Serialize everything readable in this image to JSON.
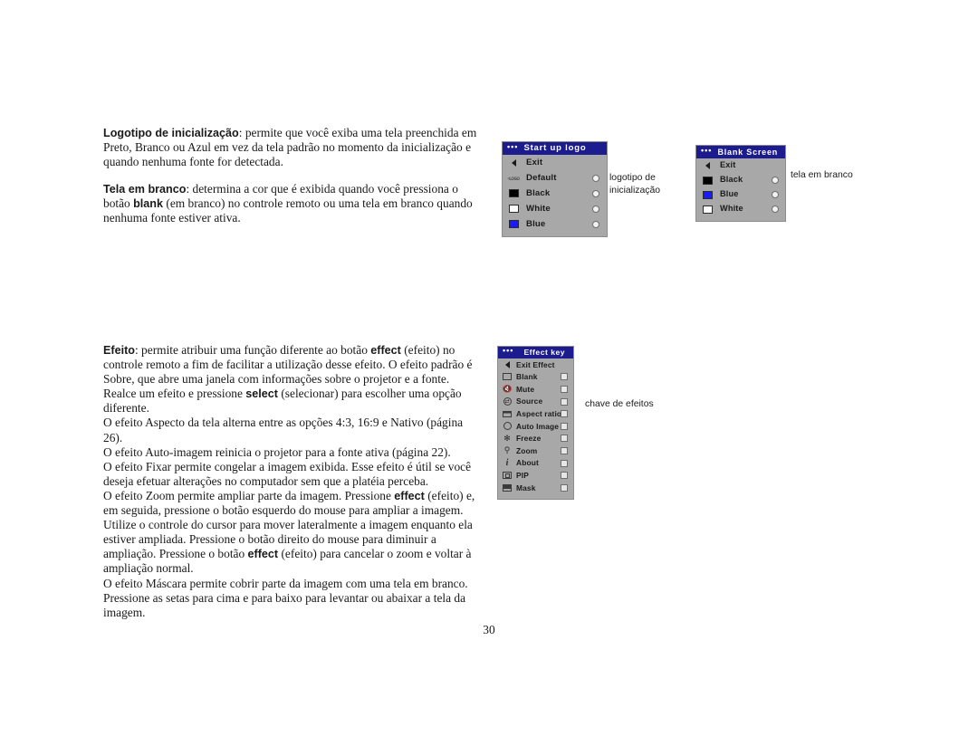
{
  "document": {
    "page_number": "30",
    "paragraphs_top": [
      {
        "lead": "Logotipo de inicialização",
        "text": ": permite que você exiba uma tela preenchida em Preto, Branco ou Azul em vez da tela padrão no momento da inicialização e quando nenhuma fonte for detectada."
      },
      {
        "lead": "Tela em branco",
        "text": ": determina a cor que é exibida quando você pressiona o botão blank (em branco) no controle remoto ou uma tela em branco quando nenhuma fonte estiver ativa."
      }
    ],
    "paragraphs_bottom": [
      {
        "lead": "Efeito",
        "text": ": permite atribuir uma função diferente ao botão effect (efeito) no controle remoto a fim de facilitar a utilização desse efeito. O efeito padrão é Sobre, que abre uma janela com informações  sobre o projetor e a fonte. Realce um efeito e pressione select (selecionar) para escolher uma opção diferente."
      },
      {
        "lead": "",
        "text": "O efeito Aspecto da tela alterna entre as opções 4:3, 16:9 e Nativo (página 26)."
      },
      {
        "lead": "",
        "text": "O efeito Auto-imagem reinicia o projetor para a fonte ativa (página 22)."
      },
      {
        "lead": "",
        "text": "O efeito Fixar permite congelar a imagem exibida. Esse efeito é útil se você deseja efetuar alterações no computador sem que a platéia perceba."
      },
      {
        "lead": "",
        "text": "O efeito Zoom permite ampliar parte da imagem. Pressione effect (efeito) e, em seguida, pressione o botão esquerdo do mouse para ampliar a imagem. Utilize o controle do cursor para mover lateralmente a imagem enquanto ela estiver ampliada. Pressione o botão direito do mouse para diminuir a ampliação. Pressione o botão effect (efeito) para cancelar o zoom e voltar à ampliação normal."
      },
      {
        "lead": "",
        "text": "O efeito Máscara permite cobrir parte da imagem com uma tela em branco. Pressione as setas para cima e para baixo para levantar ou abaixar a tela da imagem."
      }
    ],
    "bold_inline_terms": [
      "blank",
      "effect",
      "select"
    ]
  },
  "colors": {
    "osd_title_bar": "#1c1c8e",
    "osd_body": "#a8a8a8",
    "swatch_black": "#000000",
    "swatch_white": "#ffffff",
    "swatch_blue": "#1a1aff"
  },
  "menus": {
    "startup_logo": {
      "title": "Start up logo",
      "title_dots": "•••",
      "caption": "logotipo de inicialização",
      "rows": [
        {
          "label": "Exit",
          "icon": "back-arrow-icon",
          "control": "none"
        },
        {
          "label": "Default",
          "icon": "logo-icon",
          "control": "radio"
        },
        {
          "label": "Black",
          "icon": "black-swatch-icon",
          "control": "radio"
        },
        {
          "label": "White",
          "icon": "white-swatch-icon",
          "control": "radio"
        },
        {
          "label": "Blue",
          "icon": "blue-swatch-icon",
          "control": "radio"
        }
      ]
    },
    "blank_screen": {
      "title": "Blank Screen",
      "title_dots": "•••",
      "caption": "tela em branco",
      "rows": [
        {
          "label": "Exit",
          "icon": "back-arrow-icon",
          "control": "none"
        },
        {
          "label": "Black",
          "icon": "black-swatch-icon",
          "control": "radio"
        },
        {
          "label": "Blue",
          "icon": "blue-swatch-icon",
          "control": "radio"
        },
        {
          "label": "White",
          "icon": "white-swatch-icon",
          "control": "radio"
        }
      ]
    },
    "effect_key": {
      "title": "Effect key",
      "title_dots": "•••",
      "caption": "chave de efeitos",
      "rows": [
        {
          "label": "Exit Effect",
          "icon": "back-arrow-icon",
          "control": "none"
        },
        {
          "label": "Blank",
          "icon": "blank-icon",
          "control": "check"
        },
        {
          "label": "Mute",
          "icon": "mute-icon",
          "control": "check"
        },
        {
          "label": "Source",
          "icon": "source-icon",
          "control": "check"
        },
        {
          "label": "Aspect ratio",
          "icon": "aspect-ratio-icon",
          "control": "check"
        },
        {
          "label": "Auto Image",
          "icon": "auto-image-icon",
          "control": "check"
        },
        {
          "label": "Freeze",
          "icon": "freeze-icon",
          "control": "check"
        },
        {
          "label": "Zoom",
          "icon": "zoom-icon",
          "control": "check"
        },
        {
          "label": "About",
          "icon": "about-icon",
          "control": "check"
        },
        {
          "label": "PIP",
          "icon": "pip-icon",
          "control": "check"
        },
        {
          "label": "Mask",
          "icon": "mask-icon",
          "control": "check"
        }
      ]
    }
  }
}
